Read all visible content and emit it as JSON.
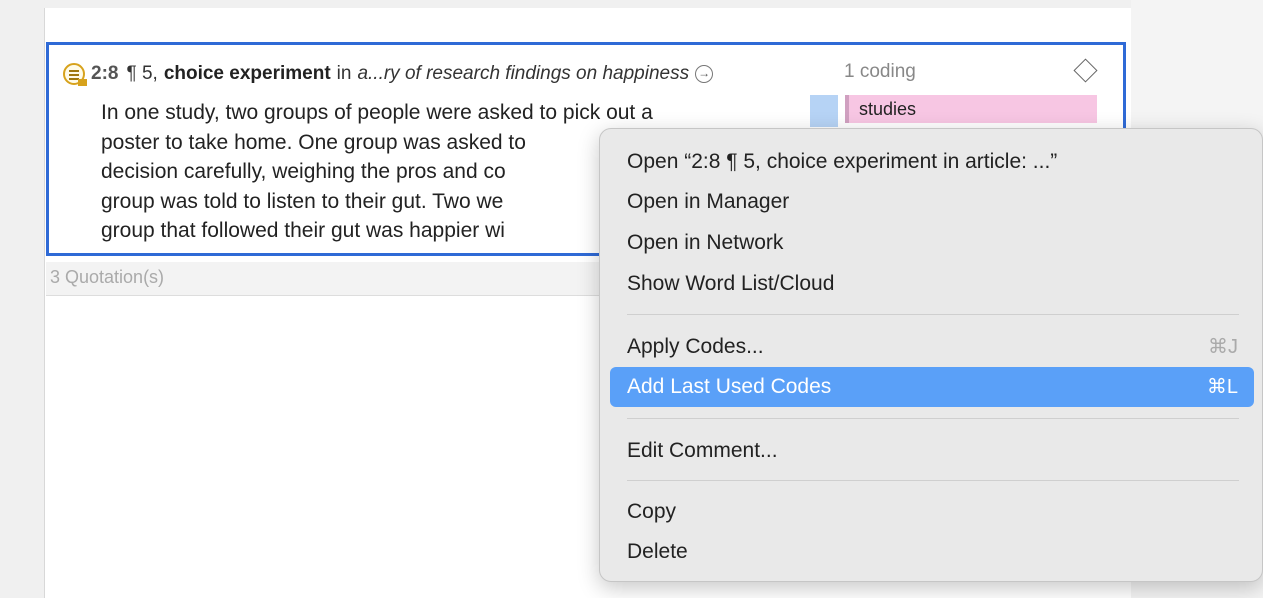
{
  "quotation": {
    "id": "2:8",
    "location": "¶ 5,",
    "name": "choice experiment",
    "in_label": "in",
    "document": "a...ry of research findings on happiness",
    "coding_count": "1 coding",
    "text_lines": [
      "In one study, two groups of people were asked to pick out a",
      "poster to take home. One group was asked to",
      "decision carefully, weighing the pros and co",
      "group was told to listen to their gut. Two we",
      "group that followed their gut was happier wi"
    ],
    "code": {
      "label": "studies",
      "color": "#f7c6e3"
    }
  },
  "status": {
    "quotation_count": "3 Quotation(s)"
  },
  "context_menu": {
    "open": "Open “2:8  ¶ 5, choice experiment in article: ...”",
    "open_in_manager": "Open in Manager",
    "open_in_network": "Open in Network",
    "show_word_list": "Show Word List/Cloud",
    "apply_codes": {
      "label": "Apply Codes...",
      "shortcut": "⌘J"
    },
    "add_last_used": {
      "label": "Add Last Used Codes",
      "shortcut": "⌘L"
    },
    "edit_comment": "Edit Comment...",
    "copy": "Copy",
    "delete": "Delete"
  },
  "colors": {
    "selection_border": "#2f6ad6",
    "menu_highlight": "#5aa0f8",
    "code_tag": "#f7c6e3"
  }
}
